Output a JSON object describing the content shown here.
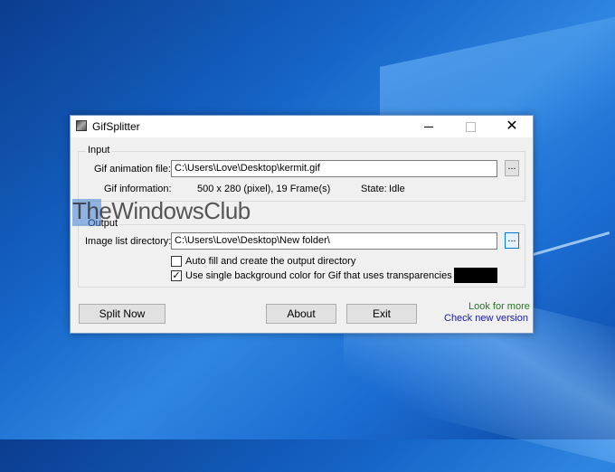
{
  "window": {
    "title": "GifSplitter",
    "minimize": "—",
    "maximize": "□",
    "close": "✕"
  },
  "input_group": {
    "label": "Input",
    "gif_file_label": "Gif animation file:",
    "gif_file_value": "C:\\Users\\Love\\Desktop\\kermit.gif",
    "browse_label": "...",
    "info_label": "Gif information:",
    "info_value": "500 x 280 (pixel), 19 Frame(s)",
    "state_label": "State:",
    "state_value": "Idle"
  },
  "output_group": {
    "label": "Output",
    "dir_label": "Image list directory:",
    "dir_value": "C:\\Users\\Love\\Desktop\\New folder\\",
    "browse_label": "...",
    "autofill_label": "Auto fill and create the output directory",
    "autofill_checked": false,
    "single_bg_label": "Use single background color for Gif that uses transparencies",
    "single_bg_checked": true,
    "bg_color": "#000000"
  },
  "buttons": {
    "split_now": "Split Now",
    "about": "About",
    "exit": "Exit"
  },
  "links": {
    "look_for_more": "Look for more",
    "check_version": "Check new version"
  },
  "watermark": {
    "text": "TheWindowsClub"
  },
  "colors": {
    "link_green": "#1f7a1f",
    "link_blue": "#1a1aa6",
    "desktop": "#1565c8"
  }
}
